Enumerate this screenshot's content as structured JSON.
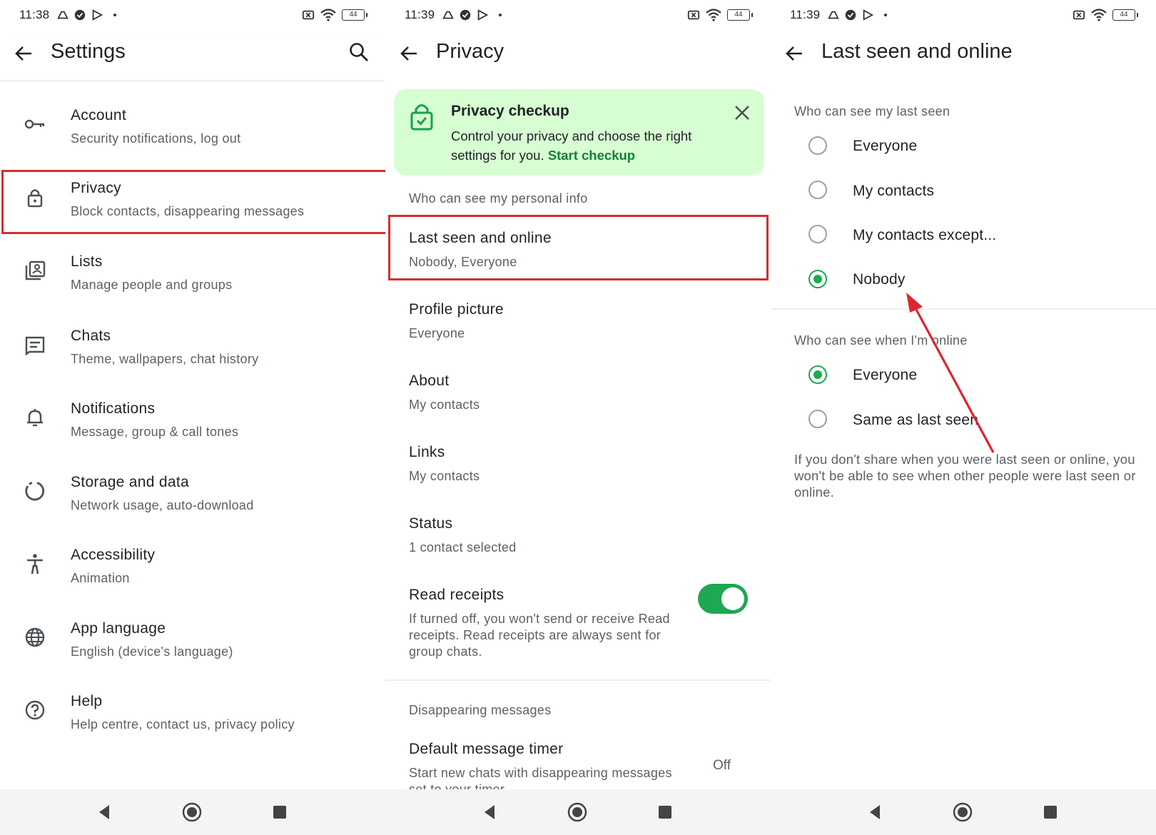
{
  "colors": {
    "accent_green": "#1da851",
    "highlight_red": "#d32f2f",
    "checkup_bg": "#d7fdd3"
  },
  "status_bars": [
    {
      "time": "11:38",
      "battery": "44"
    },
    {
      "time": "11:39",
      "battery": "44"
    },
    {
      "time": "11:39",
      "battery": "44"
    }
  ],
  "settings": {
    "title": "Settings",
    "items": [
      {
        "icon": "key-icon",
        "label": "Account",
        "sub": "Security notifications, log out"
      },
      {
        "icon": "lock-icon",
        "label": "Privacy",
        "sub": "Block contacts, disappearing messages"
      },
      {
        "icon": "contacts-list-icon",
        "label": "Lists",
        "sub": "Manage people and groups"
      },
      {
        "icon": "chat-icon",
        "label": "Chats",
        "sub": "Theme, wallpapers, chat history"
      },
      {
        "icon": "bell-icon",
        "label": "Notifications",
        "sub": "Message, group & call tones"
      },
      {
        "icon": "storage-circle-icon",
        "label": "Storage and data",
        "sub": "Network usage, auto-download"
      },
      {
        "icon": "accessibility-icon",
        "label": "Accessibility",
        "sub": "Animation"
      },
      {
        "icon": "globe-icon",
        "label": "App language",
        "sub": "English (device's language)"
      },
      {
        "icon": "help-icon",
        "label": "Help",
        "sub": "Help centre, contact us, privacy policy"
      }
    ]
  },
  "privacy": {
    "title": "Privacy",
    "checkup": {
      "title": "Privacy checkup",
      "desc": "Control your privacy and choose the right settings for you.",
      "link": "Start checkup"
    },
    "section_personal": "Who can see my personal info",
    "items": [
      {
        "label": "Last seen and online",
        "value": "Nobody, Everyone"
      },
      {
        "label": "Profile picture",
        "value": "Everyone"
      },
      {
        "label": "About",
        "value": "My contacts"
      },
      {
        "label": "Links",
        "value": "My contacts"
      },
      {
        "label": "Status",
        "value": "1 contact selected"
      }
    ],
    "read_receipts": {
      "label": "Read receipts",
      "desc": "If turned off, you won't send or receive Read receipts. Read receipts are always sent for group chats.",
      "enabled": true
    },
    "section_disappearing": "Disappearing messages",
    "default_timer": {
      "label": "Default message timer",
      "desc": "Start new chats with disappearing messages set to your timer",
      "value": "Off"
    }
  },
  "last_seen": {
    "title": "Last seen and online",
    "section_last_seen": "Who can see my last seen",
    "last_seen_options": [
      "Everyone",
      "My contacts",
      "My contacts except...",
      "Nobody"
    ],
    "last_seen_selected": "Nobody",
    "section_online": "Who can see when I'm online",
    "online_options": [
      "Everyone",
      "Same as last seen"
    ],
    "online_selected": "Everyone",
    "note": "If you don't share when you were last seen or online, you won't be able to see when other people were last seen or online."
  }
}
